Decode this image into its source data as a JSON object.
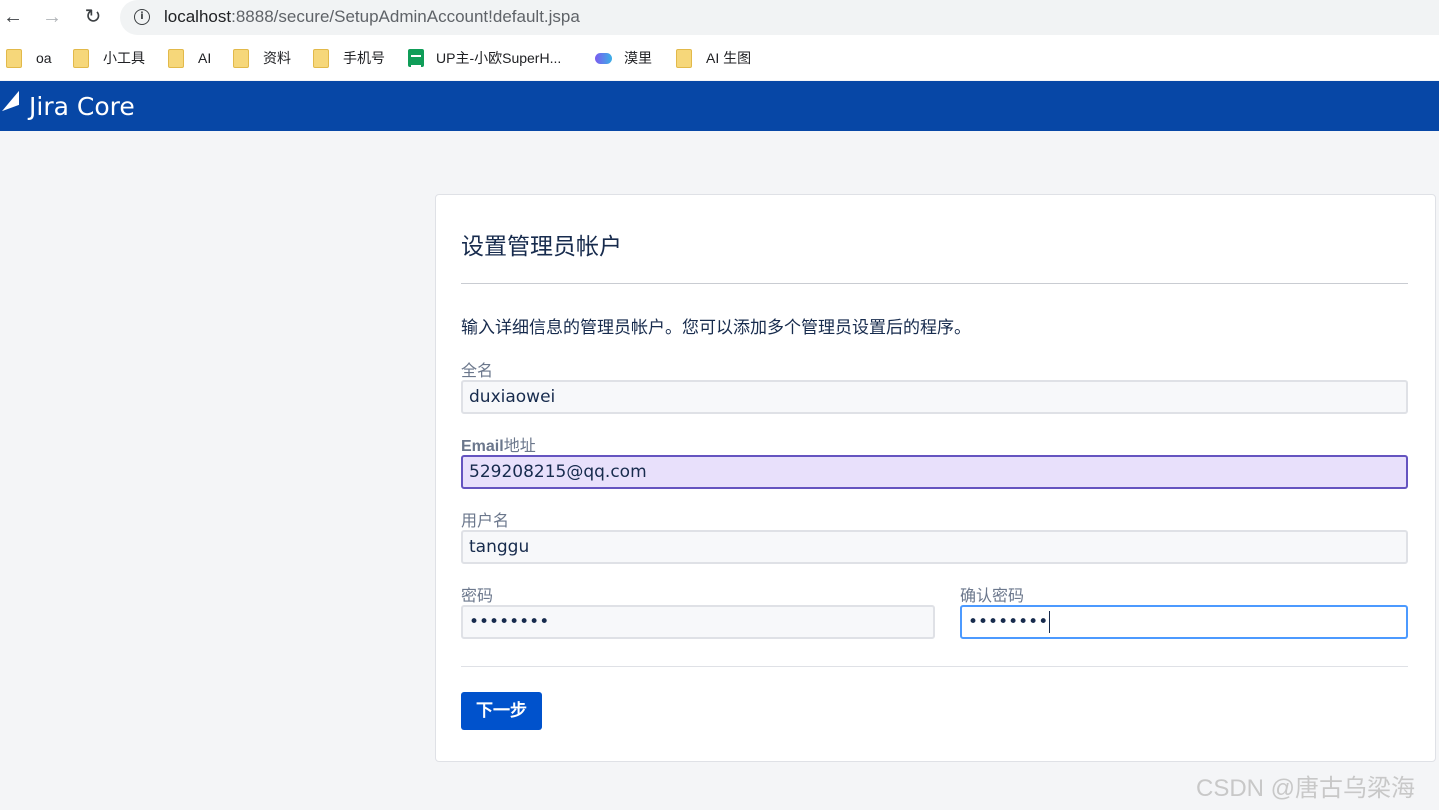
{
  "browser": {
    "url_host": "localhost",
    "url_path": ":8888/secure/SetupAdminAccount!default.jspa",
    "bookmarks": [
      "oa",
      "小工具",
      "AI",
      "资料",
      "手机号",
      "UP主-小欧SuperH...",
      "漠里",
      "AI 生图"
    ]
  },
  "app": {
    "name": "Jira Core"
  },
  "form": {
    "title": "设置管理员帐户",
    "description": "输入详细信息的管理员帐户。您可以添加多个管理员设置后的程序。",
    "fullname_label": "全名",
    "fullname_value": "duxiaowei",
    "email_label_bold": "Email",
    "email_label_rest": "地址",
    "email_value": "529208215@qq.com",
    "username_label": "用户名",
    "username_value": "tanggu",
    "password_label": "密码",
    "password_value": "••••••••",
    "confirm_label": "确认密码",
    "confirm_value": "••••••••",
    "next_button": "下一步"
  },
  "watermark": "CSDN @唐古乌梁海",
  "colors": {
    "header": "#0747a6",
    "button": "#0052cc",
    "autofill": "#e8e0fb",
    "focus_border": "#4c9aff"
  }
}
